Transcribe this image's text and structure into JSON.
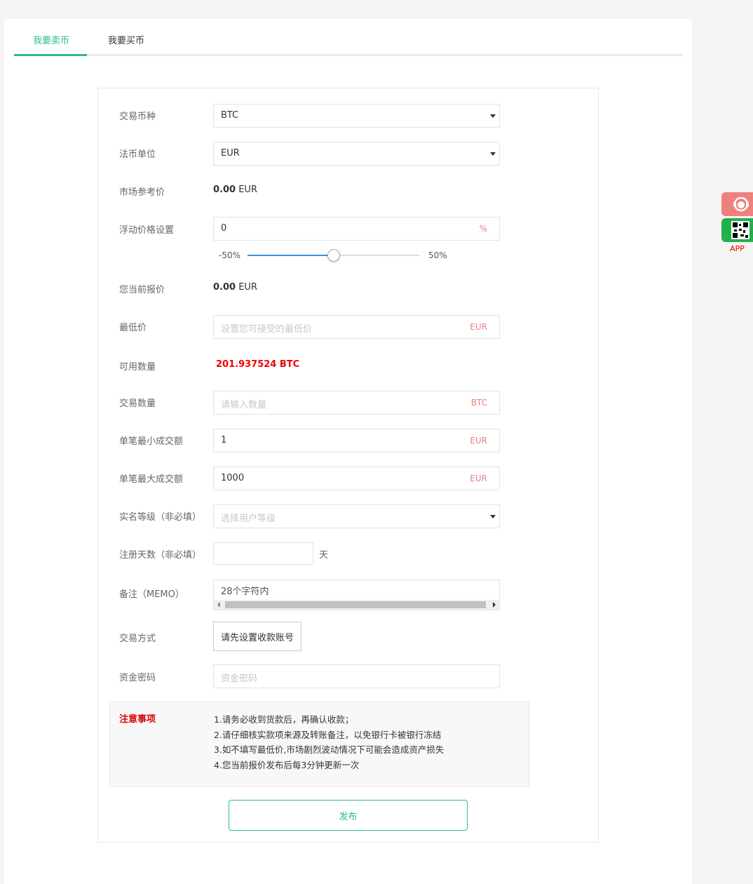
{
  "tabs": [
    {
      "label": "我要卖币",
      "active": true
    },
    {
      "label": "我要买币",
      "active": false
    }
  ],
  "form": {
    "currency": {
      "label": "交易币种",
      "value": "BTC"
    },
    "fiat": {
      "label": "法币单位",
      "value": "EUR"
    },
    "market_price": {
      "label": "市场参考价",
      "amount": "0.00",
      "unit": "EUR"
    },
    "float_price": {
      "label": "浮动价格设置",
      "value": "0",
      "unit": "%",
      "slider_min": "-50%",
      "slider_max": "50%",
      "slider_position": 0.5
    },
    "current_quote": {
      "label": "您当前报价",
      "amount": "0.00",
      "unit": "EUR"
    },
    "min_price": {
      "label": "最低价",
      "placeholder": "设置您可接受的最低价",
      "unit": "EUR"
    },
    "available": {
      "label": "可用数量",
      "value": "201.937524 BTC"
    },
    "trade_amount": {
      "label": "交易数量",
      "placeholder": "请输入数量",
      "unit": "BTC"
    },
    "min_trade": {
      "label": "单笔最小成交额",
      "value": "1",
      "unit": "EUR"
    },
    "max_trade": {
      "label": "单笔最大成交额",
      "value": "1000",
      "unit": "EUR"
    },
    "kyc_level": {
      "label": "实名等级（非必填）",
      "placeholder": "选择用户等级"
    },
    "reg_days": {
      "label": "注册天数（非必填）",
      "unit": "天"
    },
    "memo": {
      "label": "备注（MEMO）",
      "value": "28个字符内"
    },
    "payment": {
      "label": "交易方式",
      "button": "请先设置收款账号"
    },
    "fund_password": {
      "label": "资金密码",
      "placeholder": "资金密码"
    }
  },
  "notice": {
    "title": "注意事项",
    "items": [
      "1.请务必收到货款后，再确认收款；",
      "2.请仔细核实款项来源及转账备注，以免银行卡被银行冻结",
      "3.如不填写最低价,市场剧烈波动情况下可能会造成资产损失",
      "4.您当前报价发布后每3分钟更新一次"
    ]
  },
  "publish_label": "发布",
  "side": {
    "app_label": "APP"
  },
  "colors": {
    "accent": "#2ebd85",
    "danger": "#e00000",
    "service": "#f07f7f",
    "app": "#22b04a"
  }
}
